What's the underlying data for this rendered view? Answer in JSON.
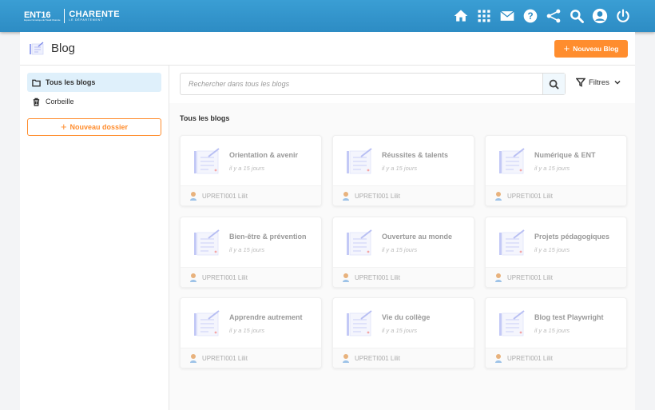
{
  "topbar": {
    "logo_ent": "ENT16",
    "logo_ent_sub": "Espace Numérique de Travail Charente",
    "logo_dept": "CHARENTE",
    "logo_dept_sub": "LE DÉPARTEMENT",
    "icons": [
      "home-icon",
      "apps-icon",
      "mail-icon",
      "help-icon",
      "share-icon",
      "search-icon",
      "user-icon",
      "power-icon"
    ]
  },
  "header": {
    "title": "Blog",
    "new_blog_label": "Nouveau Blog"
  },
  "sidebar": {
    "items": [
      {
        "label": "Tous les blogs",
        "icon": "folder-icon",
        "active": true
      },
      {
        "label": "Corbeille",
        "icon": "trash-icon",
        "active": false
      }
    ],
    "new_folder_label": "Nouveau dossier"
  },
  "main": {
    "search_placeholder": "Rechercher dans tous les blogs",
    "filters_label": "Filtres",
    "section_title": "Tous les blogs",
    "blogs": [
      {
        "title": "Orientation & avenir",
        "date": "il y a 15 jours",
        "author": "UPRETI001 Lilit"
      },
      {
        "title": "Réussites & talents",
        "date": "il y a 15 jours",
        "author": "UPRETI001 Lilit"
      },
      {
        "title": "Numérique & ENT",
        "date": "il y a 15 jours",
        "author": "UPRETI001 Lilit"
      },
      {
        "title": "Bien-être & prévention",
        "date": "il y a 15 jours",
        "author": "UPRETI001 Lilit"
      },
      {
        "title": "Ouverture au monde",
        "date": "il y a 15 jours",
        "author": "UPRETI001 Lilit"
      },
      {
        "title": "Projets pédagogiques",
        "date": "il y a 15 jours",
        "author": "UPRETI001 Lilit"
      },
      {
        "title": "Apprendre autrement",
        "date": "il y a 15 jours",
        "author": "UPRETI001 Lilit"
      },
      {
        "title": "Vie du collège",
        "date": "il y a 15 jours",
        "author": "UPRETI001 Lilit"
      },
      {
        "title": "Blog test Playwright",
        "date": "il y a 15 jours",
        "author": "UPRETI001 Lilit"
      }
    ]
  },
  "colors": {
    "topbar": "#2d8cc4",
    "accent": "#ff8d2e",
    "active_bg": "#dff0fb"
  }
}
